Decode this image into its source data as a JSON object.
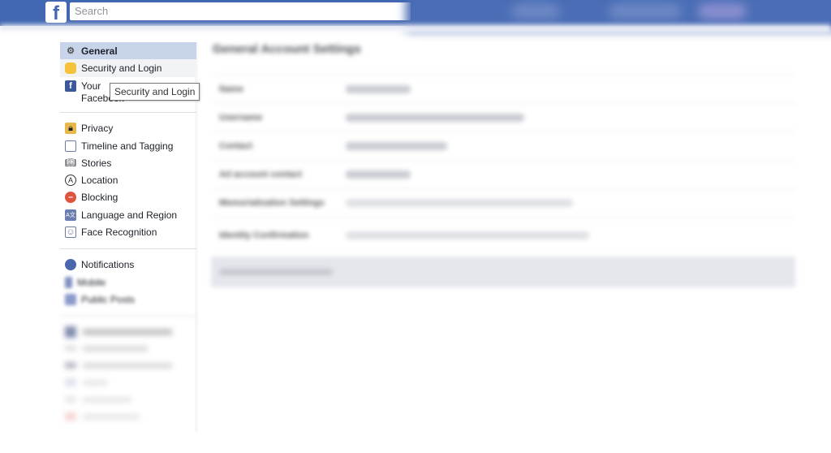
{
  "header": {
    "logo": "f",
    "search_placeholder": "Search",
    "color": "#4267b2"
  },
  "sidebar": {
    "groups": [
      [
        {
          "label": "General",
          "icon": "gears-icon"
        },
        {
          "label": "Security and Login",
          "icon": "shield-badge-icon"
        },
        {
          "label": "Your Facebook Information",
          "icon": "facebook-icon"
        }
      ],
      [
        {
          "label": "Privacy",
          "icon": "lock-icon"
        },
        {
          "label": "Timeline and Tagging",
          "icon": "timeline-icon"
        },
        {
          "label": "Stories",
          "icon": "book-icon"
        },
        {
          "label": "Location",
          "icon": "location-icon"
        },
        {
          "label": "Blocking",
          "icon": "blocking-icon"
        },
        {
          "label": "Language and Region",
          "icon": "language-icon"
        },
        {
          "label": "Face Recognition",
          "icon": "face-recognition-icon"
        }
      ],
      [
        {
          "label": "Notifications",
          "icon": "globe-icon"
        },
        {
          "label": "Mobile",
          "icon": "mobile-icon"
        },
        {
          "label": "Public Posts",
          "icon": "public-posts-icon"
        }
      ]
    ],
    "active": "General",
    "tooltip": "Security and Login"
  },
  "main": {
    "title": "General Account Settings",
    "rows": [
      {
        "label": "Name"
      },
      {
        "label": "Username"
      },
      {
        "label": "Contact"
      },
      {
        "label": "Ad account contact"
      },
      {
        "label": "Memorialization Settings"
      },
      {
        "label": "Identity Confirmation"
      }
    ]
  }
}
